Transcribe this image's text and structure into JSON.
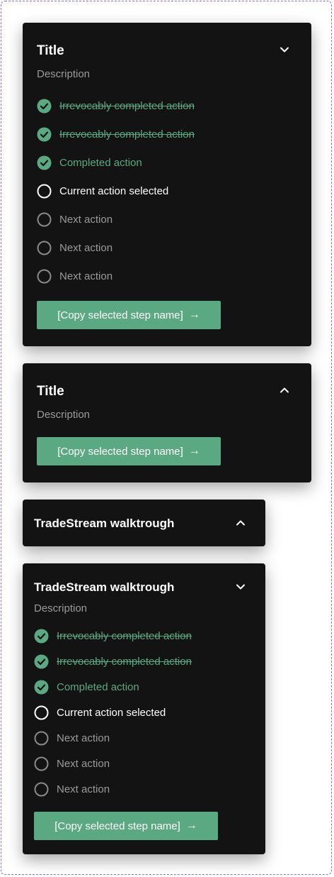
{
  "icons": {
    "check": "check-circle-icon",
    "empty": "circle-icon",
    "chevron_down": "chevron-down-icon",
    "chevron_up": "chevron-up-icon",
    "arrow_right": "arrow-right-icon"
  },
  "colors": {
    "accent": "#5aa983",
    "card_bg": "#131313",
    "muted": "#9a9a9a",
    "frame": "#8b6cf2"
  },
  "card1": {
    "title": "Title",
    "description": "Description",
    "steps": [
      {
        "label": "Irrevocably completed action",
        "state": "irrevocable"
      },
      {
        "label": "Irrevocably completed action",
        "state": "irrevocable"
      },
      {
        "label": "Completed action",
        "state": "completed"
      },
      {
        "label": "Current action selected",
        "state": "current"
      },
      {
        "label": "Next action",
        "state": "next"
      },
      {
        "label": "Next action",
        "state": "next"
      },
      {
        "label": "Next action",
        "state": "next"
      }
    ],
    "button_label": "[Copy selected step name]",
    "arrow": "→"
  },
  "card2": {
    "title": "Title",
    "description": "Description",
    "button_label": "[Copy selected step name]",
    "arrow": "→"
  },
  "card3": {
    "title": "TradeStream walktrough"
  },
  "card4": {
    "title": "TradeStream walktrough",
    "description": "Description",
    "steps": [
      {
        "label": "Irrevocably completed action",
        "state": "irrevocable"
      },
      {
        "label": "Irrevocably completed action",
        "state": "irrevocable"
      },
      {
        "label": "Completed action",
        "state": "completed"
      },
      {
        "label": "Current action selected",
        "state": "current"
      },
      {
        "label": "Next action",
        "state": "next"
      },
      {
        "label": "Next action",
        "state": "next"
      },
      {
        "label": "Next action",
        "state": "next"
      }
    ],
    "button_label": "[Copy selected step name]",
    "arrow": "→"
  }
}
